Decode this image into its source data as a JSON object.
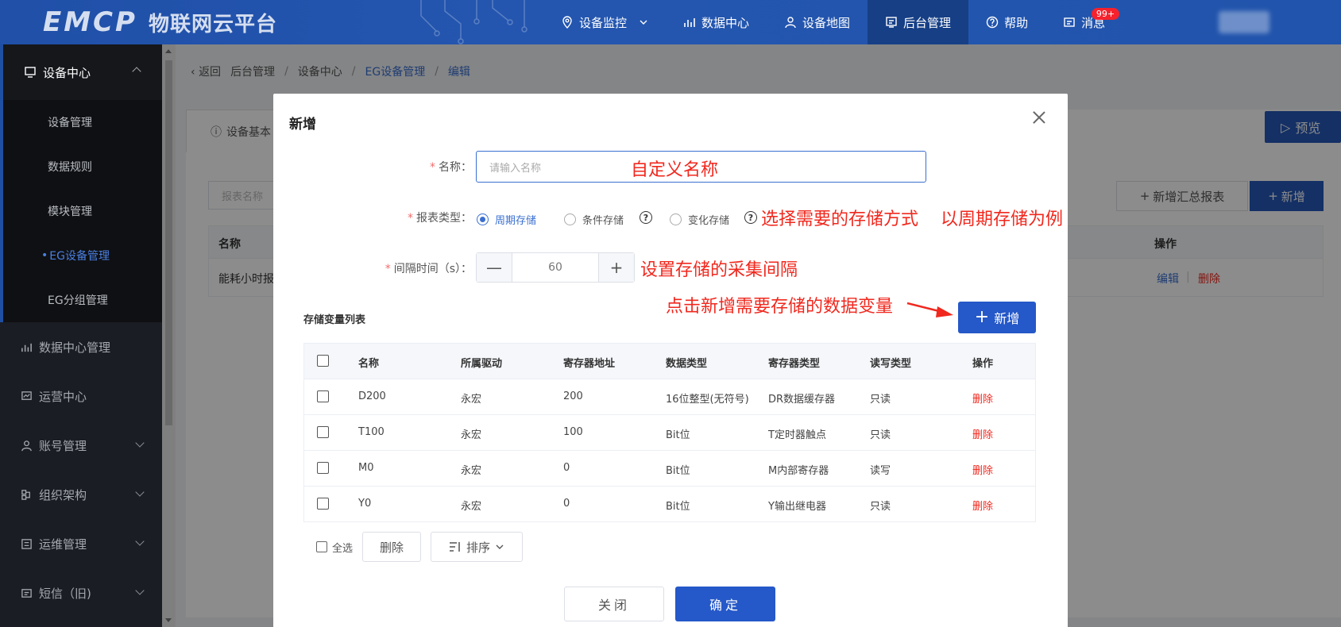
{
  "header": {
    "logo_mark": "EMCP",
    "logo_text": "物联网云平台",
    "nav": [
      {
        "label": "设备监控",
        "icon": "location-icon",
        "has_dropdown": true
      },
      {
        "label": "数据中心",
        "icon": "chart-icon"
      },
      {
        "label": "设备地图",
        "icon": "user-pin-icon"
      },
      {
        "label": "后台管理",
        "icon": "admin-icon",
        "active": true
      },
      {
        "label": "帮助",
        "icon": "help-circle-icon"
      },
      {
        "label": "消息",
        "icon": "message-icon",
        "badge": "99+"
      }
    ]
  },
  "sidebar": {
    "group_title": "设备中心",
    "sub_items": [
      "设备管理",
      "数据规则",
      "模块管理",
      "EG设备管理",
      "EG分组管理"
    ],
    "active_sub": "EG设备管理",
    "items": [
      "数据中心管理",
      "运营中心",
      "账号管理",
      "组织架构",
      "运维管理",
      "短信（旧)"
    ]
  },
  "breadcrumb": {
    "back": "返回",
    "path": [
      "后台管理",
      "设备中心",
      "EG设备管理",
      "编辑"
    ]
  },
  "background": {
    "tab_label": "设备基本",
    "preview_label": "预览",
    "search_placeholder": "报表名称",
    "add_summary_label": "新增汇总报表",
    "add_label": "新增",
    "col_name": "名称",
    "col_ops": "操作",
    "row_name": "能耗小时报",
    "row_edit": "编辑",
    "row_delete": "删除"
  },
  "modal": {
    "title": "新增",
    "name_label": "名称：",
    "name_placeholder": "请输入名称",
    "type_label": "报表类型：",
    "type_options": [
      "周期存储",
      "条件存储",
      "变化存储"
    ],
    "type_selected": "周期存储",
    "interval_label": "间隔时间（s）：",
    "interval_value": "60",
    "minus": "—",
    "plus": "+",
    "list_title": "存储变量列表",
    "add_label": "新增",
    "columns": [
      "名称",
      "所属驱动",
      "寄存器地址",
      "数据类型",
      "寄存器类型",
      "读写类型",
      "操作"
    ],
    "rows": [
      [
        "D200",
        "永宏",
        "200",
        "16位整型(无符号)",
        "DR数据缓存器",
        "只读",
        "删除"
      ],
      [
        "T100",
        "永宏",
        "100",
        "Bit位",
        "T定时器触点",
        "只读",
        "删除"
      ],
      [
        "M0",
        "永宏",
        "0",
        "Bit位",
        "M内部寄存器",
        "读写",
        "删除"
      ],
      [
        "Y0",
        "永宏",
        "0",
        "Bit位",
        "Y输出继电器",
        "只读",
        "删除"
      ]
    ],
    "select_all": "全选",
    "delete_label": "删除",
    "sort_label": "排序",
    "close_label": "关闭",
    "ok_label": "确定"
  },
  "annotations": {
    "name": "自定义名称",
    "type": "选择需要的存储方式",
    "type_example": "以周期存储为例",
    "interval": "设置存储的采集间隔",
    "add": "点击新增需要存储的数据变量",
    "color": "#f0281e"
  },
  "colors": {
    "header": "#1f4fa3",
    "primary": "#2558c8",
    "danger": "#f0281e",
    "sidebar": "#1a1d23"
  }
}
